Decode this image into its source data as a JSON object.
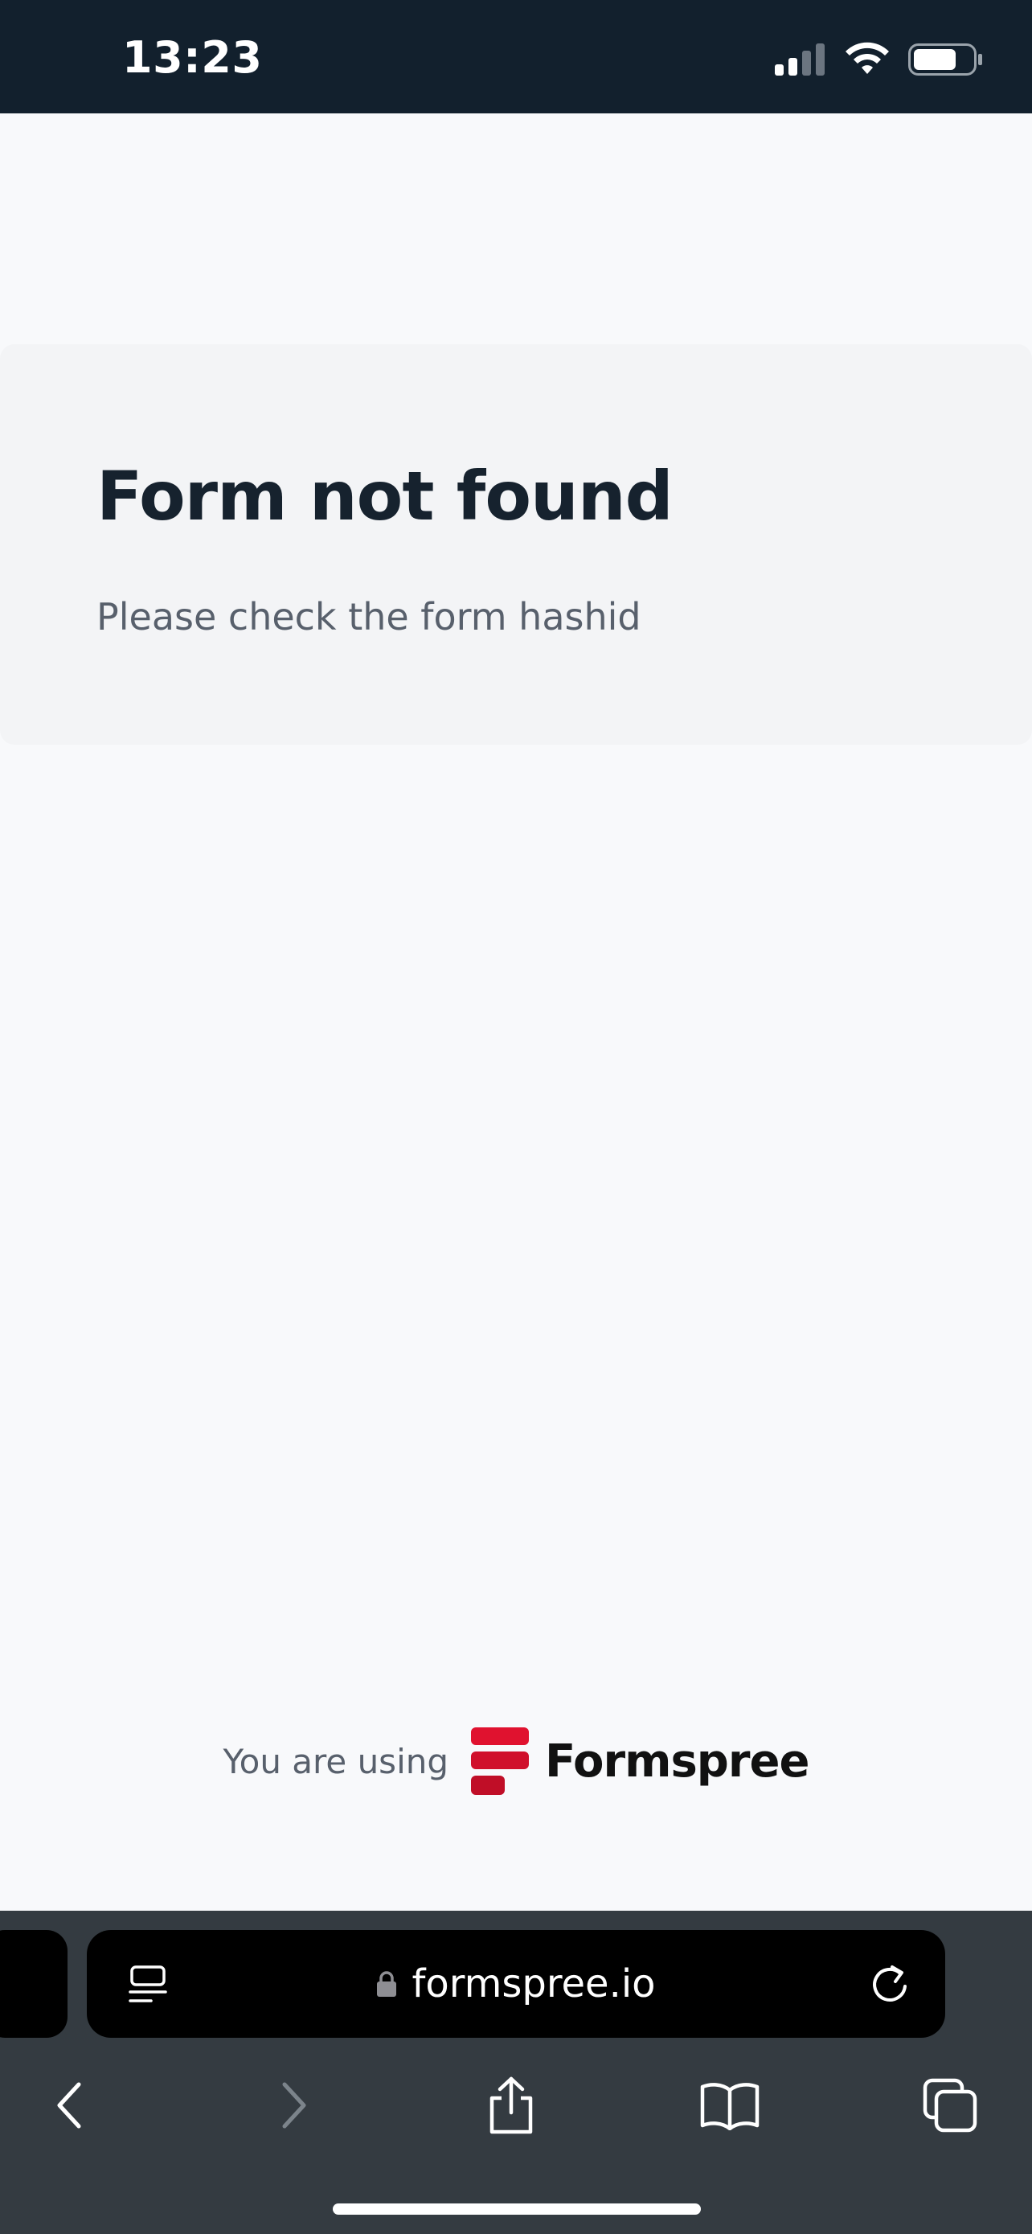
{
  "status_bar": {
    "time": "13:23",
    "icons": [
      "cellular-signal-icon",
      "wifi-icon",
      "battery-icon"
    ]
  },
  "error_card": {
    "title": "Form not found",
    "message": "Please check the form hashid"
  },
  "branding": {
    "prefix": "You are using",
    "brand_name": "Formspree",
    "brand_color": "#e0122f"
  },
  "browser": {
    "url": "formspree.io",
    "toolbar_icons": [
      "back-icon",
      "forward-icon",
      "share-icon",
      "bookmarks-icon",
      "tabs-icon"
    ]
  },
  "colors": {
    "status_bar_bg": "#12202d",
    "page_bg": "#f8f9fb",
    "card_bg": "#f3f4f6",
    "chrome_bg": "#343b41"
  }
}
